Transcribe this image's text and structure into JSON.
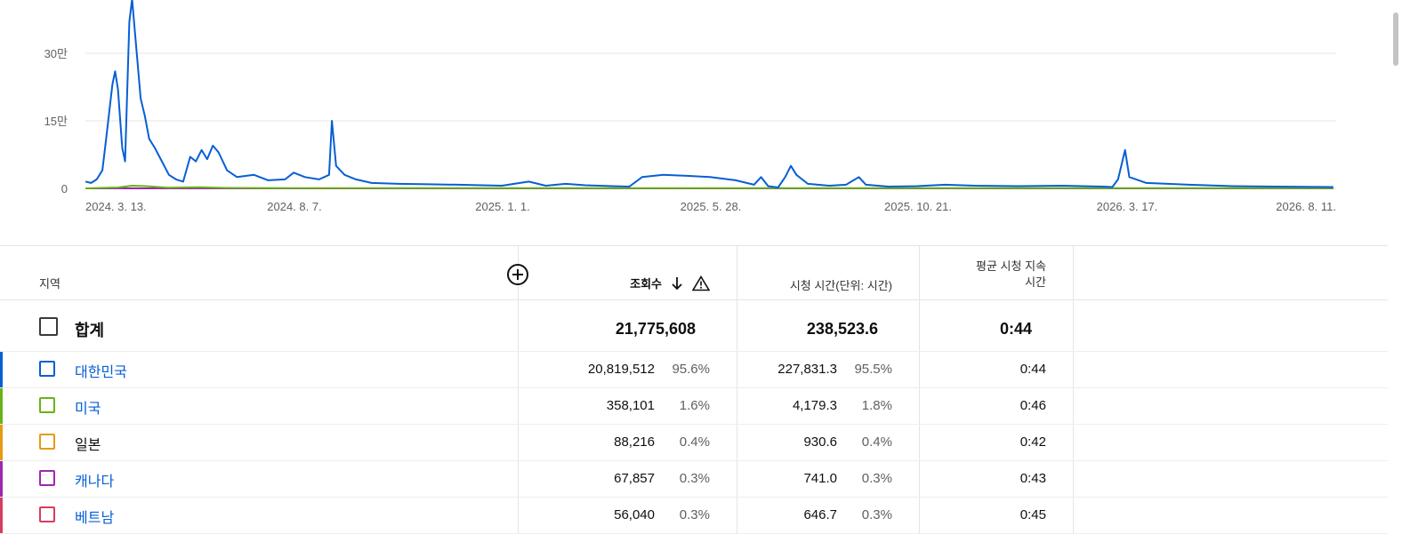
{
  "chart_data": {
    "type": "line",
    "y_ticks": [
      "30만",
      "15만",
      "0"
    ],
    "y_tick_values": [
      300000,
      150000,
      0
    ],
    "ylim": [
      0,
      420000
    ],
    "x_ticks": [
      "2024. 3. 13.",
      "2024. 8. 7.",
      "2025. 1. 1.",
      "2025. 5. 28.",
      "2025. 10. 21.",
      "2026. 3. 17.",
      "2026. 8. 11."
    ],
    "xlim": [
      "2024-03-13",
      "2026-08-13"
    ],
    "grid": true,
    "series": [
      {
        "name": "대한민국",
        "color": "#065fd4",
        "points": [
          [
            "2024-03-13",
            15000
          ],
          [
            "2024-03-17",
            12000
          ],
          [
            "2024-03-21",
            20000
          ],
          [
            "2024-03-25",
            40000
          ],
          [
            "2024-03-28",
            120000
          ],
          [
            "2024-04-01",
            230000
          ],
          [
            "2024-04-03",
            260000
          ],
          [
            "2024-04-05",
            220000
          ],
          [
            "2024-04-08",
            90000
          ],
          [
            "2024-04-10",
            60000
          ],
          [
            "2024-04-13",
            370000
          ],
          [
            "2024-04-15",
            420000
          ],
          [
            "2024-04-18",
            310000
          ],
          [
            "2024-04-21",
            200000
          ],
          [
            "2024-04-24",
            160000
          ],
          [
            "2024-04-27",
            110000
          ],
          [
            "2024-05-01",
            90000
          ],
          [
            "2024-05-06",
            60000
          ],
          [
            "2024-05-11",
            30000
          ],
          [
            "2024-05-16",
            20000
          ],
          [
            "2024-05-21",
            15000
          ],
          [
            "2024-05-26",
            70000
          ],
          [
            "2024-05-30",
            60000
          ],
          [
            "2024-06-03",
            85000
          ],
          [
            "2024-06-07",
            65000
          ],
          [
            "2024-06-11",
            95000
          ],
          [
            "2024-06-15",
            80000
          ],
          [
            "2024-06-21",
            40000
          ],
          [
            "2024-06-28",
            25000
          ],
          [
            "2024-07-10",
            30000
          ],
          [
            "2024-07-20",
            18000
          ],
          [
            "2024-08-01",
            20000
          ],
          [
            "2024-08-07",
            35000
          ],
          [
            "2024-08-15",
            25000
          ],
          [
            "2024-08-25",
            20000
          ],
          [
            "2024-09-01",
            30000
          ],
          [
            "2024-09-03",
            150000
          ],
          [
            "2024-09-06",
            50000
          ],
          [
            "2024-09-12",
            30000
          ],
          [
            "2024-09-20",
            20000
          ],
          [
            "2024-10-01",
            12000
          ],
          [
            "2024-10-20",
            10000
          ],
          [
            "2024-11-10",
            9000
          ],
          [
            "2024-12-01",
            8000
          ],
          [
            "2025-01-01",
            6000
          ],
          [
            "2025-01-20",
            15000
          ],
          [
            "2025-02-01",
            6000
          ],
          [
            "2025-02-15",
            10000
          ],
          [
            "2025-03-01",
            7000
          ],
          [
            "2025-03-20",
            5000
          ],
          [
            "2025-04-01",
            4000
          ],
          [
            "2025-04-10",
            25000
          ],
          [
            "2025-04-25",
            30000
          ],
          [
            "2025-05-10",
            28000
          ],
          [
            "2025-05-28",
            25000
          ],
          [
            "2025-06-15",
            18000
          ],
          [
            "2025-06-28",
            8000
          ],
          [
            "2025-07-03",
            25000
          ],
          [
            "2025-07-08",
            5000
          ],
          [
            "2025-07-15",
            2000
          ],
          [
            "2025-07-20",
            25000
          ],
          [
            "2025-07-24",
            50000
          ],
          [
            "2025-07-28",
            30000
          ],
          [
            "2025-08-05",
            10000
          ],
          [
            "2025-08-20",
            6000
          ],
          [
            "2025-09-01",
            8000
          ],
          [
            "2025-09-10",
            25000
          ],
          [
            "2025-09-15",
            8000
          ],
          [
            "2025-10-01",
            4000
          ],
          [
            "2025-10-21",
            5000
          ],
          [
            "2025-11-10",
            8000
          ],
          [
            "2025-12-01",
            6000
          ],
          [
            "2026-01-01",
            5000
          ],
          [
            "2026-02-01",
            6000
          ],
          [
            "2026-03-01",
            4000
          ],
          [
            "2026-03-08",
            3000
          ],
          [
            "2026-03-12",
            20000
          ],
          [
            "2026-03-17",
            85000
          ],
          [
            "2026-03-20",
            25000
          ],
          [
            "2026-04-01",
            12000
          ],
          [
            "2026-05-01",
            8000
          ],
          [
            "2026-06-01",
            5000
          ],
          [
            "2026-07-01",
            4000
          ],
          [
            "2026-08-11",
            3000
          ]
        ]
      },
      {
        "name": "미국",
        "color": "#6ab216",
        "points": [
          [
            "2024-03-13",
            0
          ],
          [
            "2024-04-05",
            2000
          ],
          [
            "2024-04-15",
            6000
          ],
          [
            "2024-04-25",
            5000
          ],
          [
            "2024-05-10",
            1500
          ],
          [
            "2024-06-01",
            2500
          ],
          [
            "2024-06-20",
            1000
          ],
          [
            "2024-08-01",
            500
          ],
          [
            "2026-08-11",
            300
          ]
        ]
      },
      {
        "name": "캐나다",
        "color": "#9c27b0",
        "points": [
          [
            "2024-03-13",
            0
          ],
          [
            "2026-08-11",
            0
          ]
        ]
      }
    ]
  },
  "table": {
    "headers": {
      "region": "지역",
      "views": "조회수",
      "watch_time": "시청 시간(단위: 시간)",
      "avg_duration_line1": "평균 시청 지속",
      "avg_duration_line2": "시간"
    },
    "total": {
      "label": "합계",
      "views": "21,775,608",
      "watch_time": "238,523.6",
      "avg_duration": "0:44"
    },
    "rows": [
      {
        "name": "대한민국",
        "color": "#065fd4",
        "name_color": "#065fd4",
        "views": "20,819,512",
        "views_pct": "95.6%",
        "watch_time": "227,831.3",
        "watch_pct": "95.5%",
        "avg": "0:44"
      },
      {
        "name": "미국",
        "color": "#6ab216",
        "name_color": "#065fd4",
        "views": "358,101",
        "views_pct": "1.6%",
        "watch_time": "4,179.3",
        "watch_pct": "1.8%",
        "avg": "0:46"
      },
      {
        "name": "일본",
        "color": "#e69b12",
        "name_color": "#0f0f0f",
        "views": "88,216",
        "views_pct": "0.4%",
        "watch_time": "930.6",
        "watch_pct": "0.4%",
        "avg": "0:42"
      },
      {
        "name": "캐나다",
        "color": "#9c27b0",
        "name_color": "#065fd4",
        "views": "67,857",
        "views_pct": "0.3%",
        "watch_time": "741.0",
        "watch_pct": "0.3%",
        "avg": "0:43"
      },
      {
        "name": "베트남",
        "color": "#d63d5e",
        "name_color": "#065fd4",
        "views": "56,040",
        "views_pct": "0.3%",
        "watch_time": "646.7",
        "watch_pct": "0.3%",
        "avg": "0:45"
      }
    ]
  }
}
